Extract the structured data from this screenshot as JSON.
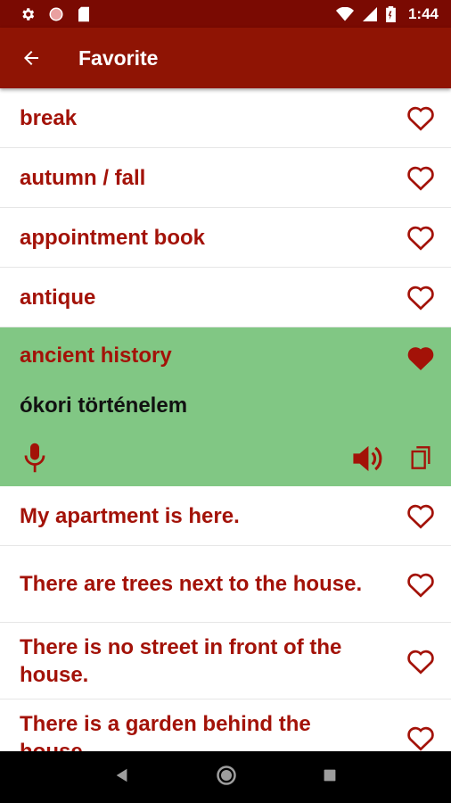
{
  "status_bar": {
    "time": "1:44",
    "left_icons": [
      "settings-icon",
      "circle-icon",
      "sd-card-icon"
    ],
    "right_icons": [
      "wifi-icon",
      "signal-icon",
      "battery-icon"
    ]
  },
  "app_bar": {
    "title": "Favorite",
    "back_icon": "arrow-back-icon"
  },
  "colors": {
    "primary_dark": "#7a0a02",
    "primary": "#8f1404",
    "accent_text": "#a31208",
    "expanded_bg": "#81c784"
  },
  "favorites": [
    {
      "text": "break",
      "favorited": false
    },
    {
      "text": "autumn / fall",
      "favorited": false
    },
    {
      "text": "appointment book",
      "favorited": false
    },
    {
      "text": "antique",
      "favorited": false
    },
    {
      "text": "ancient history",
      "favorited": true,
      "expanded": true,
      "translation": "ókori történelem"
    },
    {
      "text": "My apartment is here.",
      "favorited": false
    },
    {
      "text": "There are trees next to the house.",
      "favorited": false
    },
    {
      "text": "There is no street in front of the house.",
      "favorited": false
    },
    {
      "text": "There is a garden behind the house.",
      "favorited": false
    }
  ],
  "expanded_actions": [
    "mic-icon",
    "speaker-icon",
    "copy-icon"
  ],
  "nav_bar": [
    "back-triangle-icon",
    "home-circle-icon",
    "recents-square-icon"
  ]
}
